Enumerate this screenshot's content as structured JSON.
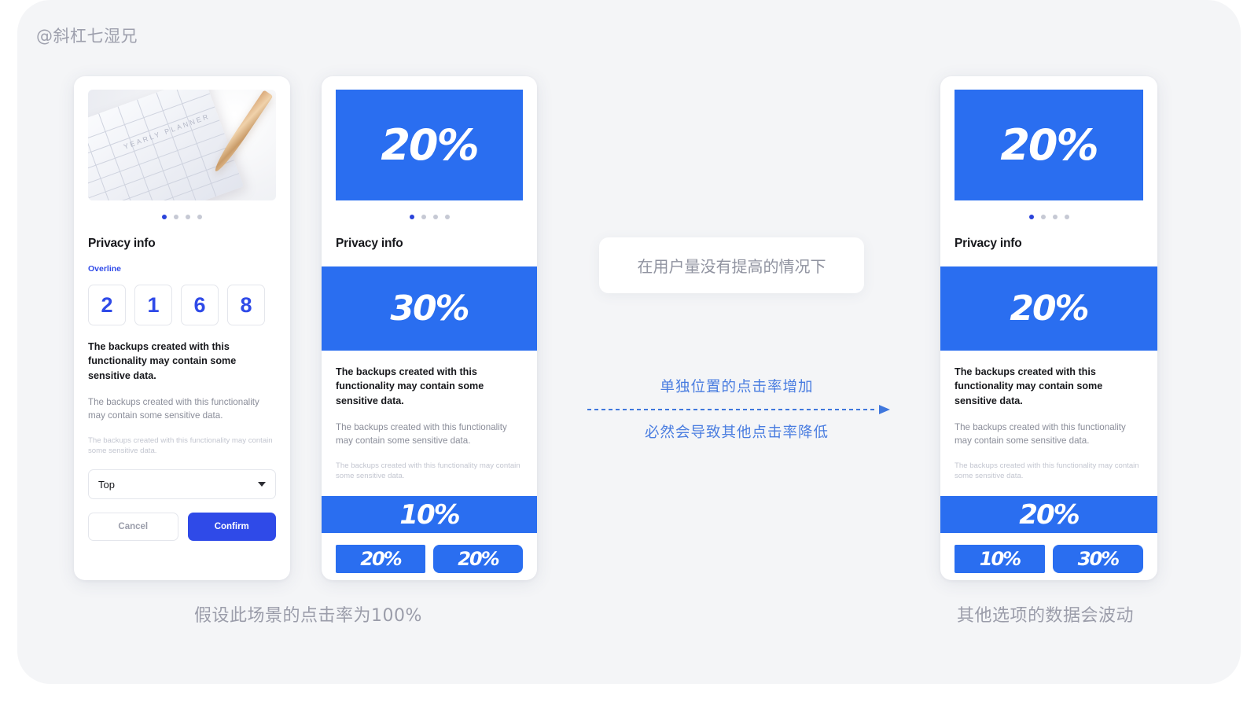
{
  "watermark": "@斜杠七湿兄",
  "theme": {
    "background": "#f4f5f7",
    "accent_blue": "#2a6ef0",
    "button_blue": "#2f4ae8",
    "arrow_blue": "#3f77dd",
    "muted_text": "#9b9daa"
  },
  "cards": [
    {
      "id": "card-1",
      "hero_type": "photo",
      "hero_photo_label": "YEARLY PLANNER",
      "dots": {
        "count": 4,
        "active_index": 0
      },
      "section_title": "Privacy info",
      "overline": "Overline",
      "otp": [
        "2",
        "1",
        "6",
        "8"
      ],
      "body_strong": "The backups created with this functionality may contain some sensitive data.",
      "body_mid": "The backups created with this functionality may contain some sensitive data.",
      "body_faint": "The backups created with this functionality may contain some sensitive data.",
      "select_value": "Top",
      "cancel_label": "Cancel",
      "confirm_label": "Confirm"
    },
    {
      "id": "card-2",
      "hero_type": "percent",
      "hero_percent": "20%",
      "dots": {
        "count": 4,
        "active_index": 0
      },
      "section_title": "Privacy info",
      "band_mid_percent": "30%",
      "body_strong": "The backups created with this functionality may contain some sensitive data.",
      "body_mid": "The backups created with this functionality may contain some sensitive data.",
      "body_faint": "The backups created with this functionality may contain some sensitive data.",
      "band_low_percent": "10%",
      "pill_left_percent": "20%",
      "pill_right_percent": "20%"
    },
    {
      "id": "card-3",
      "hero_type": "percent",
      "hero_percent": "20%",
      "dots": {
        "count": 4,
        "active_index": 0
      },
      "section_title": "Privacy info",
      "band_mid_percent": "20%",
      "body_strong": "The backups created with this functionality may contain some sensitive data.",
      "body_mid": "The backups created with this functionality may contain some sensitive data.",
      "body_faint": "The backups created with this functionality may contain some sensitive data.",
      "band_low_percent": "20%",
      "pill_left_percent": "10%",
      "pill_right_percent": "30%"
    }
  ],
  "annotations": {
    "note": "在用户量没有提高的情况下",
    "arrow_label_top": "单独位置的点击率增加",
    "arrow_label_bottom": "必然会导致其他点击率降低"
  },
  "captions": {
    "left": "假设此场景的点击率为100%",
    "right": "其他选项的数据会波动"
  }
}
